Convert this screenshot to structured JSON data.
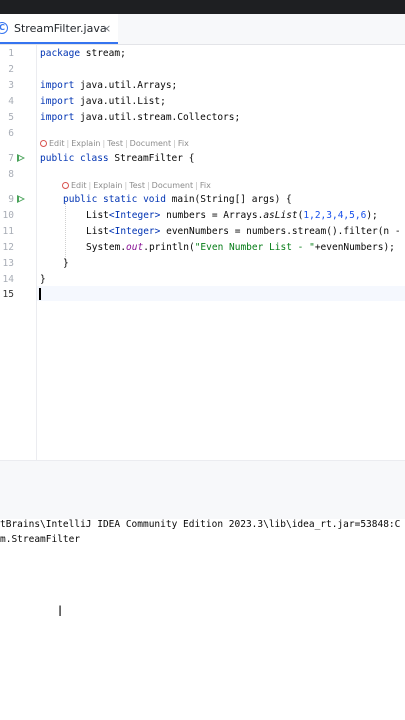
{
  "tab": {
    "label": "StreamFilter.java",
    "close": "×",
    "icon_letter": "C"
  },
  "line_numbers": [
    "1",
    "2",
    "3",
    "4",
    "5",
    "6",
    "7",
    "8",
    "9",
    "10",
    "11",
    "12",
    "13",
    "14",
    "15"
  ],
  "code": {
    "l1_kw": "package",
    "l1_rest": " stream;",
    "l3_kw": "import",
    "l3_rest": " java.util.Arrays;",
    "l4_kw": "import",
    "l4_rest": " java.util.List;",
    "l5_kw": "import",
    "l5_rest": " java.util.stream.Collectors;",
    "l7_kw": "public class",
    "l7_rest": " StreamFilter {",
    "l9_kw": "public static void",
    "l9_rest": " main(String[] args) {",
    "l10_a": "List",
    "l10_b": "<Integer>",
    "l10_c": " numbers = Arrays.",
    "l10_d": "asList",
    "l10_e": "(",
    "l10_n": "1,2,3,4,5,6",
    "l10_f": ");",
    "l11_a": "List",
    "l11_b": "<Integer>",
    "l11_c": " evenNumbers = numbers.stream().filter(n -",
    "l12_a": "System.",
    "l12_b": "out",
    "l12_c": ".println(",
    "l12_d": "\"Even Number List - \"",
    "l12_e": "+evenNumbers);",
    "l13": "}",
    "l14": "}"
  },
  "hints": [
    "Edit",
    "Explain",
    "Test",
    "Document",
    "Fix"
  ],
  "console": {
    "line1": "tBrains\\IntelliJ IDEA Community Edition 2023.3\\lib\\idea_rt.jar=53848:C",
    "line2": "m.StreamFilter"
  },
  "icons": {
    "run": "run-gutter-icon",
    "class": "class-icon",
    "ai": "ai-assistant-icon"
  }
}
